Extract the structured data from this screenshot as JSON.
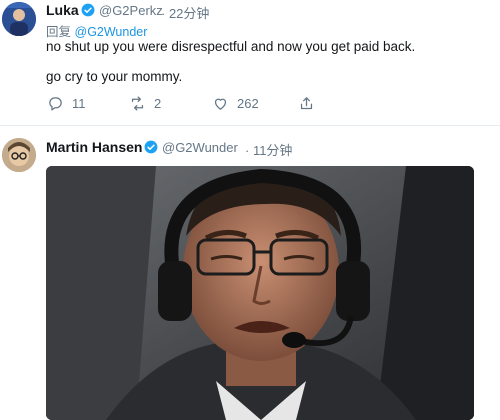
{
  "tweet1": {
    "name": "Luka",
    "handle": "@G2Perkz",
    "time": "· 22分钟",
    "reply_prefix": "回复",
    "reply_handle": "@G2Wunder",
    "lines": [
      "no shut up you were disrespectful and now you get paid back.",
      "go cry to your mommy."
    ],
    "actions": {
      "reply_count": "11",
      "retweet_count": "2",
      "like_count": "262"
    }
  },
  "tweet2": {
    "name": "Martin Hansen",
    "handle": "@G2Wunder",
    "time": "· 11分钟"
  },
  "colors": {
    "text": "#14171a",
    "secondary": "#657786",
    "link": "#1b95e0",
    "verified": "#1da1f2"
  },
  "icons": [
    "verified-badge-icon",
    "reply-icon",
    "retweet-icon",
    "like-icon",
    "share-icon"
  ]
}
